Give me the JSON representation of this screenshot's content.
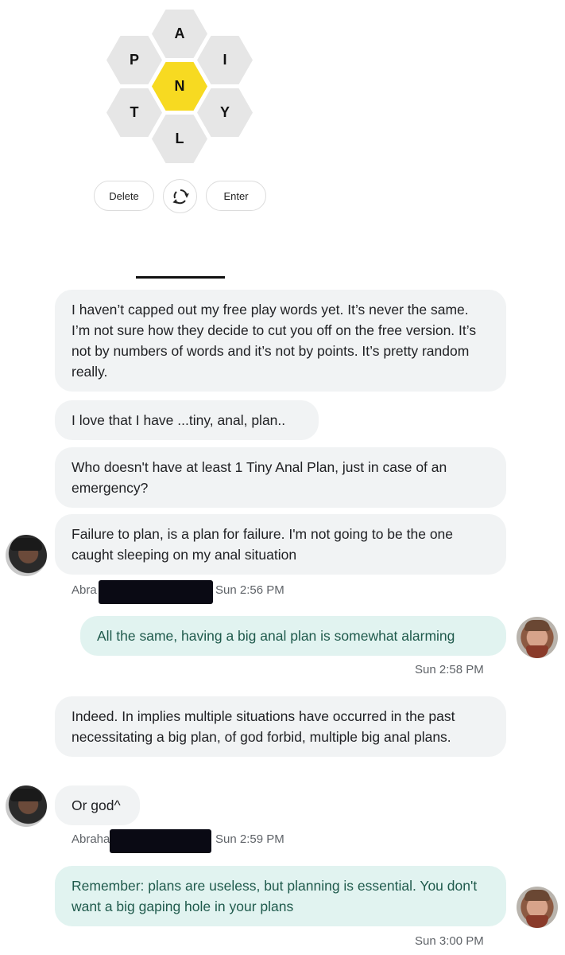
{
  "game": {
    "letters": {
      "top": "A",
      "upper_left": "P",
      "upper_right": "I",
      "center": "N",
      "lower_left": "T",
      "lower_right": "Y",
      "bottom": "L"
    },
    "buttons": {
      "delete": "Delete",
      "shuffle_icon": "refresh-icon",
      "enter": "Enter"
    },
    "colors": {
      "center_hex": "#f7da21",
      "outer_hex": "#e6e6e6"
    }
  },
  "chat": {
    "colors": {
      "incoming": "#f1f3f4",
      "outgoing": "#e1f3f0"
    },
    "messages": [
      {
        "text": "I haven’t capped out my free play words yet. It’s never the same. I’m not sure how they decide to cut you off on the free version. It’s not by numbers of words and it’s not by points. It’s pretty random really."
      },
      {
        "text": "I love that I have ...tiny, anal, plan.."
      },
      {
        "text": "Who doesn't have at least 1 Tiny Anal Plan, just in case of an emergency?"
      },
      {
        "text": "Failure to plan, is a plan for failure. I'm not going to be the one caught sleeping on my anal situation"
      },
      {
        "text": "All the same, having a big anal plan is somewhat alarming"
      },
      {
        "text": "Indeed. In implies multiple situations have occurred in the past necessitating a big plan, of god forbid, multiple big anal plans."
      },
      {
        "text": "Or god^"
      },
      {
        "text": "Remember: plans are useless, but planning is essential. You don't want a big gaping hole in your plans"
      }
    ],
    "meta": [
      {
        "sender": "Abra",
        "time": "Sun 2:56 PM"
      },
      {
        "time": "Sun 2:58 PM"
      },
      {
        "sender": "Abraha",
        "time": "Sun 2:59 PM"
      },
      {
        "time": "Sun 3:00 PM"
      }
    ]
  }
}
